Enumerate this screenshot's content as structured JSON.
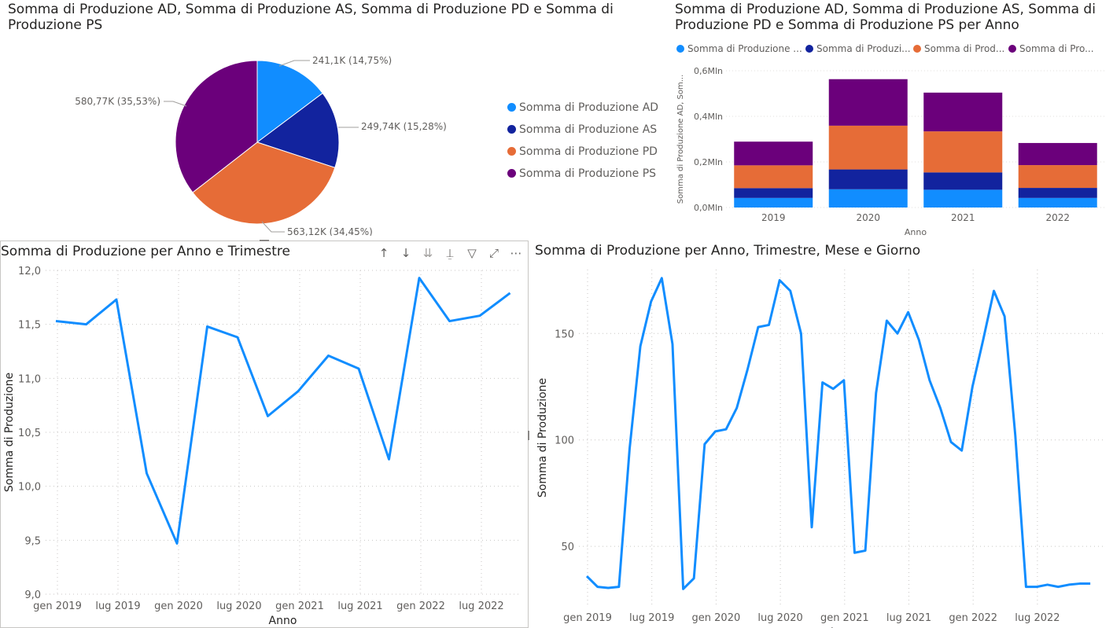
{
  "colors": {
    "ad": "#118dff",
    "as": "#12239e",
    "pd": "#e66c37",
    "ps": "#6b007b",
    "line": "#118dff"
  },
  "pie": {
    "title": "Somma di Produzione AD, Somma di Produzione AS, Somma di Produzione PD e Somma di Produzione PS",
    "legend": [
      "Somma di Produzione AD",
      "Somma di Produzione AS",
      "Somma di Produzione PD",
      "Somma di Produzione PS"
    ],
    "labels": [
      "241,1K (14,75%)",
      "249,74K (15,28%)",
      "563,12K (34,45%)",
      "580,77K (35,53%)"
    ]
  },
  "stacked": {
    "title": "Somma di Produzione AD, Somma di Produzione AS, Somma di Produzione PD e Somma di Produzione PS per Anno",
    "legend": [
      "Somma di Produzione ...",
      "Somma di Produzi...",
      "Somma di Prod...",
      "Somma di Pro..."
    ],
    "yaxis_title": "Somma di Produzione AD, Som...",
    "xaxis_title": "Anno",
    "yticks": [
      "0,0Mln",
      "0,2Mln",
      "0,4Mln",
      "0,6Mln"
    ]
  },
  "line1": {
    "title": "Somma di Produzione per Anno e Trimestre",
    "yaxis_title": "Somma di Produzione",
    "xaxis_title": "Anno",
    "yticks": [
      "9,0",
      "9,5",
      "10,0",
      "10,5",
      "11,0",
      "11,5",
      "12,0"
    ],
    "xticks": [
      "gen 2019",
      "lug 2019",
      "gen 2020",
      "lug 2020",
      "gen 2021",
      "lug 2021",
      "gen 2022",
      "lug 2022"
    ]
  },
  "line2": {
    "title": "Somma di Produzione per Anno, Trimestre, Mese e Giorno",
    "yaxis_title": "Somma di Produzione",
    "xaxis_title": "Anno",
    "yticks": [
      "50",
      "100",
      "150"
    ],
    "xticks": [
      "gen 2019",
      "lug 2019",
      "gen 2020",
      "lug 2020",
      "gen 2021",
      "lug 2021",
      "gen 2022",
      "lug 2022"
    ]
  },
  "chart_data": [
    {
      "type": "pie",
      "title": "Somma di Produzione AD, Somma di Produzione AS, Somma di Produzione PD e Somma di Produzione PS",
      "categories": [
        "Somma di Produzione AD",
        "Somma di Produzione AS",
        "Somma di Produzione PD",
        "Somma di Produzione PS"
      ],
      "values": [
        241100,
        249740,
        563120,
        580770
      ],
      "percent": [
        14.75,
        15.28,
        34.45,
        35.53
      ],
      "legend": "right"
    },
    {
      "type": "bar",
      "stacked": true,
      "title": "Somma di Produzione AD, Somma di Produzione AS, Somma di Produzione PD e Somma di Produzione PS per Anno",
      "categories": [
        "2019",
        "2020",
        "2021",
        "2022"
      ],
      "series": [
        {
          "name": "Somma di Produzione AD",
          "values": [
            42000,
            80000,
            78000,
            42000
          ]
        },
        {
          "name": "Somma di Produzione AS",
          "values": [
            43000,
            87000,
            76000,
            44000
          ]
        },
        {
          "name": "Somma di Produzione PD",
          "values": [
            100000,
            192000,
            180000,
            100000
          ]
        },
        {
          "name": "Somma di Produzione PS",
          "values": [
            104000,
            204000,
            170000,
            97000
          ]
        }
      ],
      "xlabel": "Anno",
      "ylabel": "Somma di Produzione AD, Som...",
      "ylim": [
        0,
        600000
      ],
      "legend": "top-left"
    },
    {
      "type": "line",
      "title": "Somma di Produzione per Anno e Trimestre",
      "x": [
        "2019-Q1",
        "2019-Q2",
        "2019-Q3",
        "2019-Q4",
        "2020-Q1",
        "2020-Q2",
        "2020-Q3",
        "2020-Q4",
        "2021-Q1",
        "2021-Q2",
        "2021-Q3",
        "2021-Q4",
        "2022-Q1",
        "2022-Q2",
        "2022-Q3",
        "2022-Q4"
      ],
      "values": [
        11.53,
        11.5,
        11.73,
        10.12,
        9.47,
        11.48,
        11.38,
        10.65,
        10.88,
        11.21,
        11.09,
        10.25,
        11.93,
        11.53,
        11.58,
        11.79
      ],
      "xlabel": "Anno",
      "ylabel": "Somma di Produzione",
      "ylim": [
        9.0,
        12.0
      ],
      "grid": true
    },
    {
      "type": "line",
      "title": "Somma di Produzione per Anno, Trimestre, Mese e Giorno",
      "x": [
        "2019-01",
        "2019-02",
        "2019-03",
        "2019-04",
        "2019-05",
        "2019-06",
        "2019-07",
        "2019-08",
        "2019-09",
        "2019-10",
        "2019-11",
        "2019-12",
        "2020-01",
        "2020-02",
        "2020-03",
        "2020-04",
        "2020-05",
        "2020-06",
        "2020-07",
        "2020-08",
        "2020-09",
        "2020-10",
        "2020-11",
        "2020-12",
        "2021-01",
        "2021-02",
        "2021-03",
        "2021-04",
        "2021-05",
        "2021-06",
        "2021-07",
        "2021-08",
        "2021-09",
        "2021-10",
        "2021-11",
        "2021-12",
        "2022-01",
        "2022-02",
        "2022-03",
        "2022-04",
        "2022-05",
        "2022-06",
        "2022-07",
        "2022-08",
        "2022-09",
        "2022-10",
        "2022-11",
        "2022-12"
      ],
      "values": [
        36,
        31,
        30.5,
        31,
        96,
        144,
        165,
        176,
        145,
        30,
        35,
        98,
        104,
        105,
        115,
        133,
        153,
        154,
        175,
        170,
        150,
        59,
        127,
        124,
        128,
        47,
        48,
        122,
        156,
        150,
        160,
        147,
        128,
        115,
        99,
        95,
        125,
        147,
        170,
        158,
        102,
        31,
        31,
        32,
        31,
        32,
        32.5,
        32.5
      ],
      "xlabel": "Anno",
      "ylabel": "Somma di Produzione",
      "ylim": [
        22,
        180
      ],
      "grid": true
    }
  ]
}
